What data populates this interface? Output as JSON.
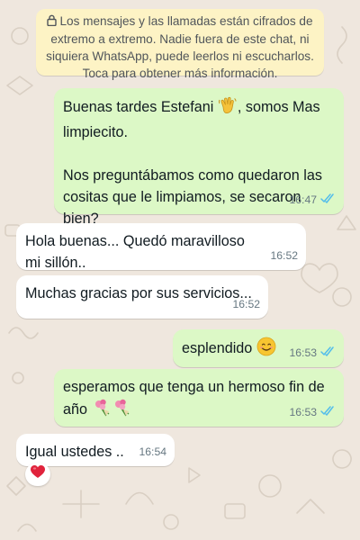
{
  "encryption_notice": "Los mensajes y las llamadas están cifrados de extremo a extremo. Nadie fuera de este chat, ni siquiera WhatsApp, puede leerlos ni escucharlos. Toca para obtener más información.",
  "messages": [
    {
      "direction": "outgoing",
      "text_before": "Buenas tardes Estefani ",
      "emoji": "waving-hand",
      "text_after": ", somos Mas limpiecito.\n\nNos preguntábamos como quedaron las cositas que le limpiamos, se secaron bien?",
      "time": "16:47",
      "read": true
    },
    {
      "direction": "incoming",
      "text": "Hola buenas... Quedó maravilloso mi sillón..",
      "time": "16:52"
    },
    {
      "direction": "incoming",
      "text": "Muchas gracias por sus servicios...",
      "time": "16:52"
    },
    {
      "direction": "outgoing",
      "text": "esplendido ",
      "emoji": "smiling-face",
      "time": "16:53",
      "read": true
    },
    {
      "direction": "outgoing",
      "text": "esperamos que tenga un hermoso fin de año ",
      "emoji": "flower-bouquet x2",
      "time": "16:53",
      "read": true
    },
    {
      "direction": "incoming",
      "text": "Igual ustedes ..",
      "time": "16:54",
      "reaction": "red-heart"
    }
  ],
  "colors": {
    "wallpaper": "#efe7de",
    "outgoing_bubble": "#dcf8c6",
    "incoming_bubble": "#ffffff",
    "notice_bubble": "#fdf3c5",
    "read_ticks": "#53bdeb",
    "timestamp": "#667781"
  },
  "icons": [
    "lock-icon",
    "double-check-icon",
    "waving-hand-emoji",
    "smiling-face-emoji",
    "bouquet-emoji",
    "red-heart-emoji"
  ]
}
